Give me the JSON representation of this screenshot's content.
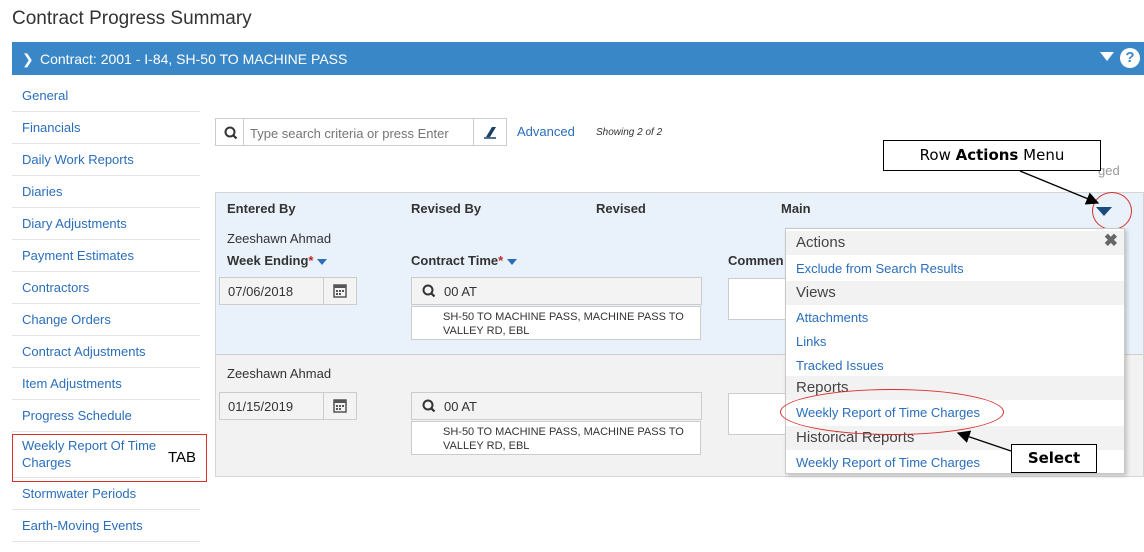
{
  "page": {
    "title": "Contract Progress Summary"
  },
  "contract_bar": {
    "title": "Contract: 2001 - I-84, SH-50 TO MACHINE PASS",
    "help_label": "?"
  },
  "sidebar": {
    "items": [
      {
        "label": "General"
      },
      {
        "label": "Financials"
      },
      {
        "label": "Daily Work Reports"
      },
      {
        "label": "Diaries"
      },
      {
        "label": "Diary Adjustments"
      },
      {
        "label": "Payment Estimates"
      },
      {
        "label": "Contractors"
      },
      {
        "label": "Change Orders"
      },
      {
        "label": "Contract Adjustments"
      },
      {
        "label": "Item Adjustments"
      },
      {
        "label": "Progress Schedule"
      },
      {
        "label": "Weekly Report Of Time Charges"
      },
      {
        "label": "Stormwater Periods"
      },
      {
        "label": "Earth-Moving Events"
      }
    ]
  },
  "annotations": {
    "tab_label": "TAB",
    "row_actions_prefix": "Row ",
    "row_actions_bold": "Actions",
    "row_actions_suffix": " Menu",
    "select_label": "Select"
  },
  "search": {
    "placeholder": "Type search criteria or press Enter",
    "advanced_label": "Advanced",
    "showing": "Showing 2 of 2",
    "changed_fragment": "ged"
  },
  "grid": {
    "headers": {
      "entered_by": "Entered By",
      "revised_by": "Revised By",
      "revised": "Revised",
      "main": "Main"
    },
    "labels": {
      "week_ending": "Week Ending",
      "contract_time": "Contract Time",
      "comments": "Commen",
      "required": "*"
    },
    "rows": [
      {
        "entered_by": "Zeeshawn Ahmad",
        "week_ending": "07/06/2018",
        "contract_time": "00 AT",
        "description": "SH-50 TO MACHINE PASS, MACHINE PASS TO VALLEY RD, EBL"
      },
      {
        "entered_by": "Zeeshawn Ahmad",
        "week_ending": "01/15/2019",
        "contract_time": "00 AT",
        "description": "SH-50 TO MACHINE PASS, MACHINE PASS TO VALLEY RD, EBL"
      }
    ]
  },
  "row_actions_menu": {
    "groups": [
      {
        "title": "Actions",
        "items": [
          "Exclude from Search Results"
        ]
      },
      {
        "title": "Views",
        "items": [
          "Attachments",
          "Links",
          "Tracked Issues"
        ]
      },
      {
        "title": "Reports",
        "items": [
          "Weekly Report of Time Charges"
        ]
      },
      {
        "title": "Historical Reports",
        "items": [
          "Weekly Report of Time Charges"
        ]
      }
    ]
  },
  "colors": {
    "accent": "#3a87c8",
    "link": "#2a6ebb",
    "annotation_red": "#d9302c",
    "selected_row": "#e9f1fa"
  }
}
